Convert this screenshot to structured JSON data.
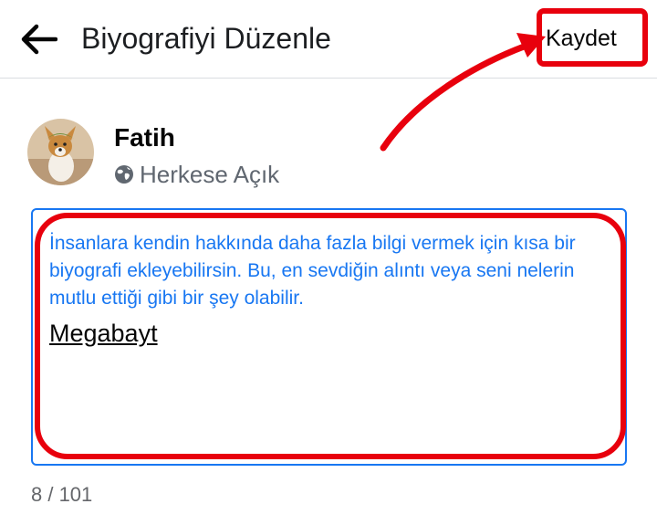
{
  "header": {
    "title": "Biyografiyi Düzenle",
    "save_label": "Kaydet",
    "back_icon": "arrow-left-icon"
  },
  "profile": {
    "name": "Fatih",
    "audience_label": "Herkese Açık",
    "audience_icon": "globe-icon"
  },
  "bio": {
    "hint": "İnsanlara kendin hakkında daha fazla bilgi vermek için kısa bir biyografi ekleyebilirsin. Bu, en sevdiğin alıntı veya seni nelerin mutlu ettiği gibi bir şey olabilir.",
    "value": "Megabayt"
  },
  "counter": "8 / 101",
  "colors": {
    "accent": "#1877f2",
    "annotation": "#e8000d",
    "secondary_text": "#65676b"
  }
}
